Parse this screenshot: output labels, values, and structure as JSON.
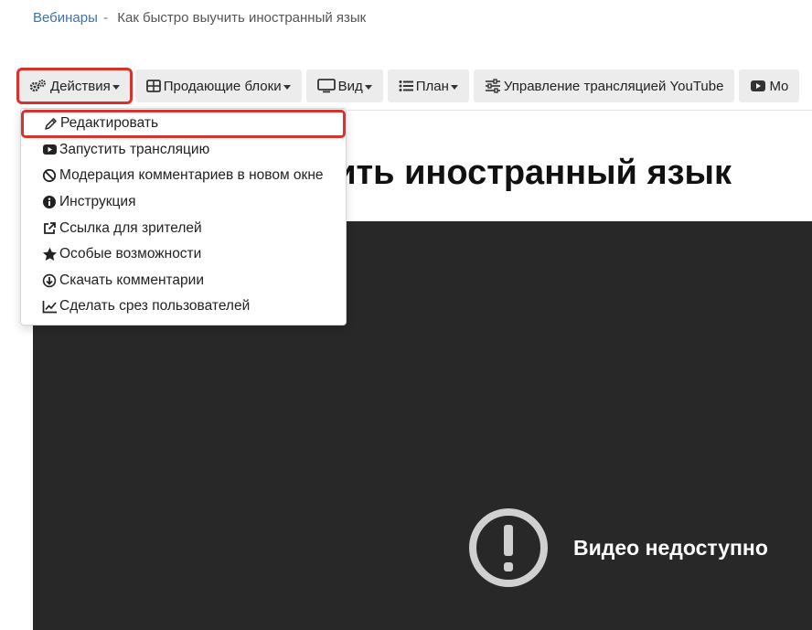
{
  "breadcrumb": {
    "link": "Вебинары",
    "separator": "-",
    "current": "Как быстро выучить иностранный язык"
  },
  "toolbar": {
    "actions": "Действия",
    "selling_blocks": "Продающие блоки",
    "view": "Вид",
    "plan": "План",
    "youtube_control": "Управление трансляцией YouTube",
    "more": "Mo"
  },
  "menu": {
    "items": [
      {
        "label": "Редактировать",
        "icon": "pencil-icon"
      },
      {
        "label": "Запустить трансляцию",
        "icon": "youtube-icon"
      },
      {
        "label": "Модерация комментариев в новом окне",
        "icon": "ban-icon"
      },
      {
        "label": "Инструкция",
        "icon": "info-icon"
      },
      {
        "label": "Ссылка для зрителей",
        "icon": "external-link-icon"
      },
      {
        "label": "Особые возможности",
        "icon": "star-icon"
      },
      {
        "label": "Скачать комментарии",
        "icon": "download-icon"
      },
      {
        "label": "Сделать срез пользователей",
        "icon": "line-chart-icon"
      }
    ]
  },
  "page": {
    "title_visible": "ить иностранный язык"
  },
  "video": {
    "error_text": "Видео недоступно"
  },
  "colors": {
    "accent_red": "#d9312b",
    "link_blue": "#3a73b4",
    "video_bg": "#282828"
  }
}
